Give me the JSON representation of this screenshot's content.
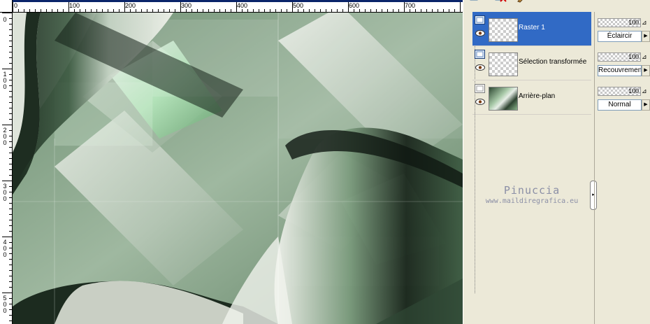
{
  "ruler": {
    "top_labels": [
      "0",
      "100",
      "200",
      "300",
      "400",
      "500",
      "600",
      "700"
    ],
    "left_labels": [
      "0",
      "100",
      "200",
      "300",
      "400",
      "500"
    ]
  },
  "layers": [
    {
      "name": "Raster 1",
      "selected": true,
      "opacity": "100",
      "blend": "Éclaircir"
    },
    {
      "name": "Sélection transformée",
      "selected": false,
      "opacity": "100",
      "blend": "Recouvrement"
    },
    {
      "name": "Arrière-plan",
      "selected": false,
      "opacity": "100",
      "blend": "Normal"
    }
  ],
  "watermark": {
    "name": "Pinuccia",
    "url": "www.maildiregrafica.eu"
  },
  "colors": {
    "selection": "#316ac5",
    "panel": "#ece9d8",
    "accent_green": "#9be3a8",
    "dark_green": "#1c2a1f"
  },
  "icons": {
    "new_layer": "layers-icon",
    "delete": "delete-icon",
    "brush": "brush-icon",
    "visibility": "eye-icon"
  }
}
